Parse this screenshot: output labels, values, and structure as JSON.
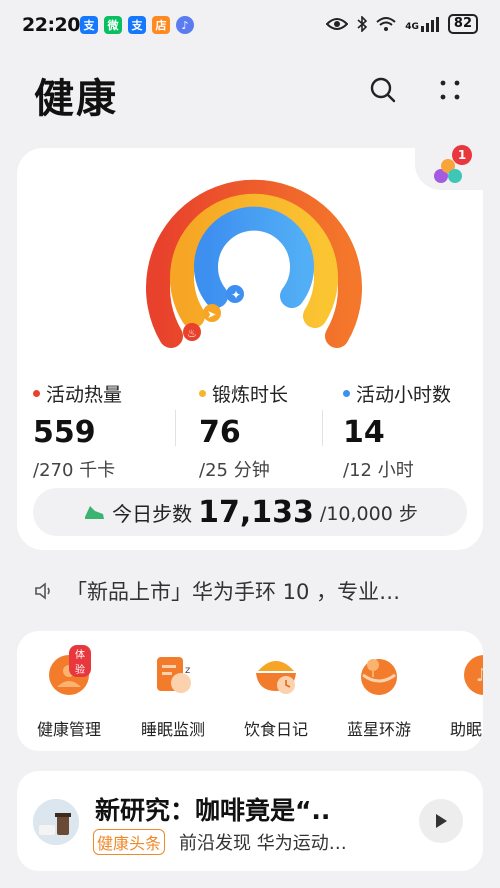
{
  "status_bar": {
    "time": "22:20",
    "apps": [
      {
        "icon": "alipay-icon",
        "glyph": "支",
        "color": "#1677ff"
      },
      {
        "icon": "wechat-icon",
        "glyph": "微",
        "color": "#07c160"
      },
      {
        "icon": "alipay-icon",
        "glyph": "支",
        "color": "#1677ff"
      },
      {
        "icon": "shopping-icon",
        "glyph": "店",
        "color": "#ff8a1f"
      },
      {
        "icon": "music-icon",
        "glyph": "♪",
        "color": "#5b7cf0"
      }
    ],
    "network": "4G",
    "battery": "82"
  },
  "header": {
    "title": "健康"
  },
  "activity": {
    "notification_count": "1",
    "calories": {
      "label": "活动热量",
      "value": "559",
      "goal": "/270 千卡",
      "color": "#e8412c"
    },
    "exercise": {
      "label": "锻炼时长",
      "value": "76",
      "goal": "/25 分钟",
      "color": "#f7b52a"
    },
    "active_hours": {
      "label": "活动小时数",
      "value": "14",
      "goal": "/12 小时",
      "color": "#3d8ff0"
    },
    "steps": {
      "label": "今日步数",
      "value": "17,133",
      "goal": "/10,000 步"
    }
  },
  "announcement": {
    "text": "「新品上市」华为手环 10 ，专业…"
  },
  "shortcuts": [
    {
      "label": "健康管理",
      "icon": "health-management-icon",
      "badge": "体验"
    },
    {
      "label": "睡眠监测",
      "icon": "sleep-monitor-icon"
    },
    {
      "label": "饮食日记",
      "icon": "diet-diary-icon"
    },
    {
      "label": "蓝星环游",
      "icon": "blue-planet-tour-icon"
    },
    {
      "label": "助眠",
      "icon": "sleep-aid-icon"
    }
  ],
  "news": {
    "title": "新研究：咖啡竟是“..",
    "tag": "健康头条",
    "subtitle": "前沿发现 华为运动…"
  }
}
